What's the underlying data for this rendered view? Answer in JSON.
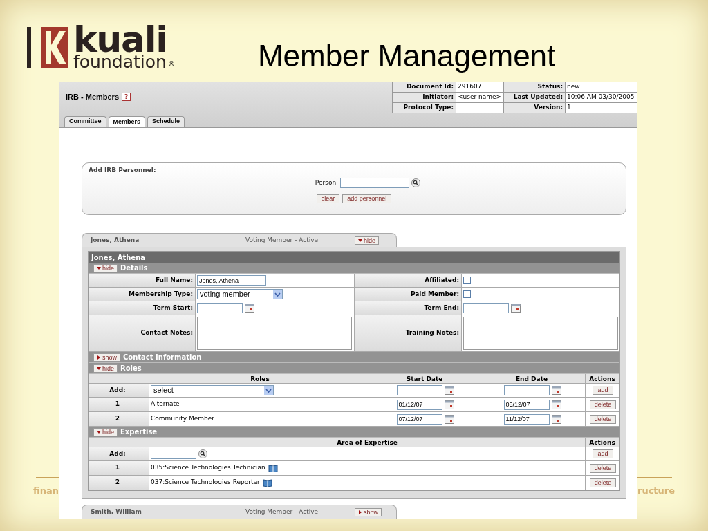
{
  "slide": {
    "title": "Member Management",
    "logo_name": "kuali",
    "logo_sub": "foundation",
    "logo_mark": "®",
    "footer_left": "finan",
    "footer_right": "ructure"
  },
  "page": {
    "title": "IRB - Members",
    "help": "?"
  },
  "doc_info": [
    {
      "label": "Document Id:",
      "value": "291607",
      "label2": "Status:",
      "value2": "new"
    },
    {
      "label": "Initiator:",
      "value": "<user name>",
      "label2": "Last Updated:",
      "value2": "10:06 AM 03/30/2005"
    },
    {
      "label": "Protocol Type:",
      "label2": "Version:",
      "value2": "1"
    }
  ],
  "tabs": [
    {
      "label": "Committee",
      "selected": false
    },
    {
      "label": "Members",
      "selected": true
    },
    {
      "label": "Schedule",
      "selected": false
    }
  ],
  "add_personnel": {
    "title": "Add IRB Personnel:",
    "person_label": "Person:",
    "buttons": [
      "clear",
      "add personnel"
    ]
  },
  "members": [
    {
      "name": "Jones, Athena",
      "status": "Voting Member - Active",
      "toggle": "hide",
      "expanded": true
    },
    {
      "name": "Smith, William",
      "status": "Voting Member - Active",
      "toggle": "show",
      "expanded": false
    }
  ],
  "detail": {
    "name_bar": "Jones, Athena",
    "details": {
      "toggle": "hide",
      "title": "Details",
      "expanded": true,
      "full_name_label": "Full Name:",
      "full_name": "Jones, Athena",
      "membership_label": "Membership Type:",
      "membership": "voting member",
      "term_start_label": "Term Start:",
      "contact_notes_label": "Contact Notes:",
      "affiliated_label": "Affiliated:",
      "affiliated": false,
      "paid_label": "Paid Member:",
      "paid": false,
      "term_end_label": "Term End:",
      "training_notes_label": "Training Notes:"
    },
    "contact": {
      "toggle": "show",
      "title": "Contact Information",
      "expanded": false
    },
    "roles": {
      "toggle": "hide",
      "title": "Roles",
      "expanded": true,
      "columns": [
        "Roles",
        "Start Date",
        "End Date",
        "Actions"
      ],
      "add_label": "Add:",
      "add_select": "select",
      "add_button": "add",
      "rows": [
        {
          "index": "1",
          "role": "Alternate",
          "start": "01/12/07",
          "end": "05/12/07",
          "action": "delete"
        },
        {
          "index": "2",
          "role": "Community Member",
          "start": "07/12/07",
          "end": "11/12/07",
          "action": "delete"
        }
      ]
    },
    "expertise": {
      "toggle": "hide",
      "title": "Expertise",
      "expanded": true,
      "columns": [
        "Area of Expertise",
        "Actions"
      ],
      "add_label": "Add:",
      "add_button": "add",
      "rows": [
        {
          "index": "1",
          "area": "035:Science Technologies Technician",
          "action": "delete"
        },
        {
          "index": "2",
          "area": "037:Science Technologies Reporter",
          "action": "delete"
        }
      ]
    }
  }
}
